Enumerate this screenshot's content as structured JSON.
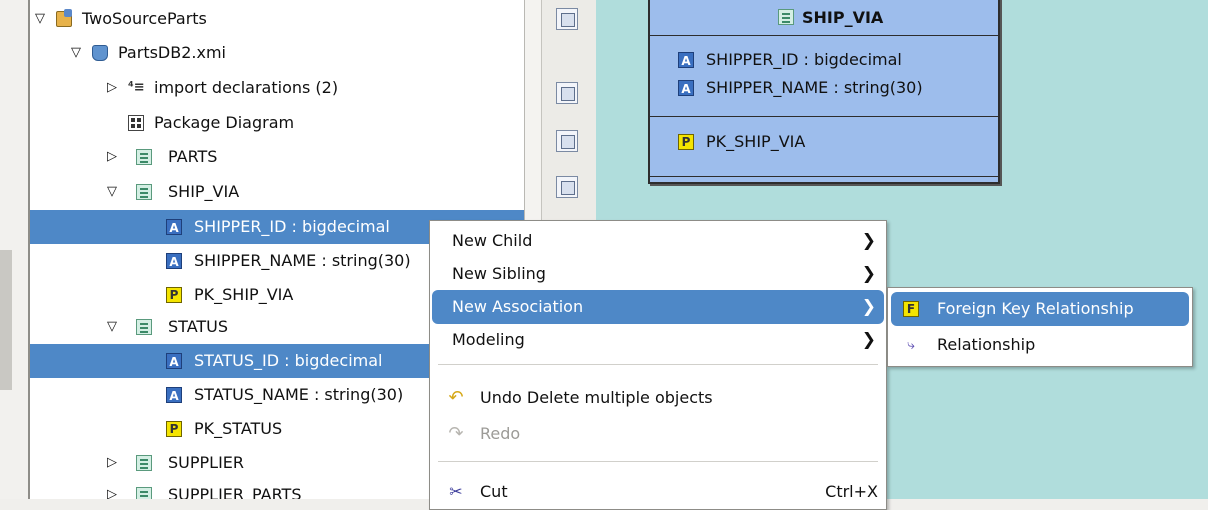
{
  "tree": {
    "rows": [
      {
        "label": "TwoSourceParts",
        "icon": "project-icon",
        "twisty": "▽"
      },
      {
        "label": "PartsDB2.xmi",
        "icon": "xmi-file-icon",
        "twisty": "▽"
      },
      {
        "label": "import declarations (2)",
        "icon": "import-declarations-icon",
        "twisty": "▷"
      },
      {
        "label": "Package Diagram",
        "icon": "package-diagram-icon",
        "twisty": ""
      },
      {
        "label": "PARTS",
        "icon": "table-icon",
        "twisty": "▷"
      },
      {
        "label": "SHIP_VIA",
        "icon": "table-icon",
        "twisty": "▽"
      },
      {
        "label": "SHIPPER_ID : bigdecimal",
        "icon": "attribute-icon",
        "twisty": "",
        "selected": true
      },
      {
        "label": "SHIPPER_NAME : string(30)",
        "icon": "attribute-icon",
        "twisty": ""
      },
      {
        "label": "PK_SHIP_VIA",
        "icon": "primary-key-icon",
        "twisty": ""
      },
      {
        "label": "STATUS",
        "icon": "table-icon",
        "twisty": "▽"
      },
      {
        "label": "STATUS_ID : bigdecimal",
        "icon": "attribute-icon",
        "twisty": "",
        "selected": true
      },
      {
        "label": "STATUS_NAME : string(30)",
        "icon": "attribute-icon",
        "twisty": ""
      },
      {
        "label": "PK_STATUS",
        "icon": "primary-key-icon",
        "twisty": ""
      },
      {
        "label": "SUPPLIER",
        "icon": "table-icon",
        "twisty": "▷"
      },
      {
        "label": "SUPPLIER_PARTS",
        "icon": "table-icon",
        "twisty": "▷"
      }
    ]
  },
  "entity": {
    "title": "SHIP_VIA",
    "attributes": [
      "SHIPPER_ID : bigdecimal",
      "SHIPPER_NAME : string(30)"
    ],
    "keys": [
      "PK_SHIP_VIA"
    ]
  },
  "context_menu": {
    "items": [
      {
        "label": "New Child",
        "submenu": true
      },
      {
        "label": "New Sibling",
        "submenu": true
      },
      {
        "label": "New Association",
        "submenu": true,
        "highlighted": true
      },
      {
        "label": "Modeling",
        "submenu": true
      },
      {
        "label": "Undo Delete multiple objects",
        "icon": "undo-icon"
      },
      {
        "label": "Redo",
        "icon": "redo-icon",
        "disabled": true
      },
      {
        "label": "Cut",
        "icon": "cut-icon",
        "shortcut": "Ctrl+X"
      }
    ],
    "arrow": "❯"
  },
  "submenu": {
    "items": [
      {
        "label": "Foreign Key Relationship",
        "icon": "foreign-key-icon",
        "highlighted": true
      },
      {
        "label": "Relationship",
        "icon": "relationship-icon"
      }
    ]
  },
  "icons": {
    "attribute": "A",
    "primary_key": "P",
    "foreign_key": "F",
    "import": "⁴≡",
    "relationship": "⤷",
    "undo": "↶",
    "redo": "↷",
    "cut": "✂"
  },
  "colors": {
    "selection": "#4e88c7",
    "canvas": "#b0dddc",
    "entity_fill": "#9dbdec"
  }
}
